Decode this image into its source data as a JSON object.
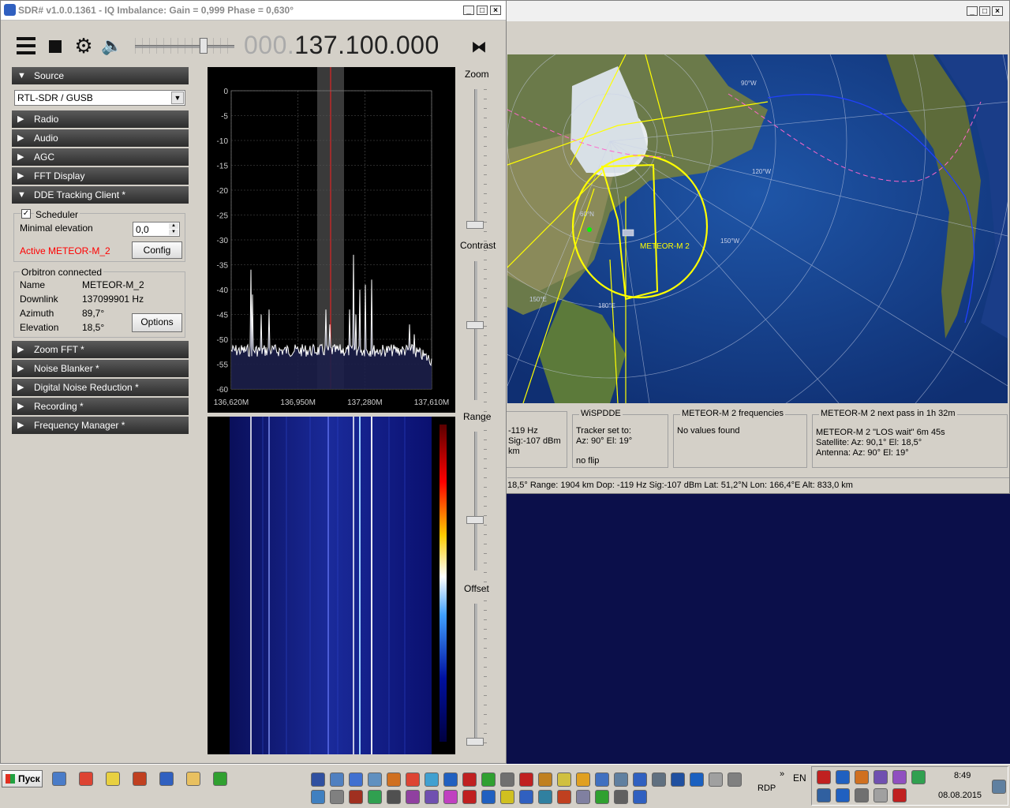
{
  "sdr": {
    "title": "SDR# v1.0.0.1361 - IQ Imbalance: Gain = 0,999 Phase = 0,630°",
    "frequency_dim": "000.",
    "frequency": "137.100.000",
    "source_value": "RTL-SDR / GUSB",
    "sections": {
      "source": "Source",
      "radio": "Radio",
      "audio": "Audio",
      "agc": "AGC",
      "fft_display": "FFT Display",
      "dde": "DDE Tracking Client *",
      "zoom_fft": "Zoom FFT *",
      "noise_blanker": "Noise Blanker *",
      "dnr": "Digital Noise Reduction *",
      "recording": "Recording *",
      "freq_manager": "Frequency Manager *"
    },
    "dde": {
      "scheduler": "Scheduler",
      "min_elev_label": "Minimal elevation",
      "min_elev_value": "0,0",
      "active": "Active METEOR-M_2",
      "config": "Config",
      "orbitron_group": "Orbitron connected",
      "name_label": "Name",
      "name_value": "METEOR-M_2",
      "downlink_label": "Downlink",
      "downlink_value": "137099901 Hz",
      "azimuth_label": "Azimuth",
      "azimuth_value": "89,7°",
      "elevation_label": "Elevation",
      "elevation_value": "18,5°",
      "options": "Options"
    },
    "fft": {
      "y_ticks": [
        "0",
        "-5",
        "-10",
        "-15",
        "-20",
        "-25",
        "-30",
        "-35",
        "-40",
        "-45",
        "-50",
        "-55",
        "-60"
      ],
      "x_ticks": [
        "136,620M",
        "136,950M",
        "137,280M",
        "137,610M"
      ]
    },
    "side": {
      "zoom": "Zoom",
      "contrast": "Contrast",
      "range": "Range",
      "offset": "Offset"
    }
  },
  "orbitron": {
    "map_labels": {
      "sat": "METEOR-M 2",
      "lon150w": "150°W",
      "lon120w": "120°W",
      "lon90w": "90°W",
      "lon180": "180°E",
      "lon150e": "150°E",
      "lat60": "60°N"
    },
    "panels": {
      "p0_l1": "-119 Hz",
      "p0_l2": "Sig:-107 dBm",
      "p0_l3": "km",
      "wispdde_title": "WiSPDDE",
      "wispdde_l1": "Tracker set to:",
      "wispdde_l2": "Az: 90°  El: 19°",
      "wispdde_l3": "no flip",
      "freq_title": "METEOR-M 2 frequencies",
      "freq_l1": "No values found",
      "next_title": "METEOR-M 2 next pass in 1h 32m",
      "next_l1": "METEOR-M 2  \"LOS wait\"  6m 45s",
      "next_l2": "Satellite:  Az: 90,1°  El: 18,5°",
      "next_l3": "Antenna:  Az: 90°  El: 19°"
    },
    "status": "18,5°  Range: 1904 km  Dop: -119 Hz  Sig:-107 dBm  Lat: 51,2°N  Lon: 166,4°E  Alt: 833,0 km"
  },
  "taskbar": {
    "start": "Пуск",
    "rdp": "RDP",
    "lang": "EN",
    "time": "8:49",
    "date": "08.08.2015"
  }
}
